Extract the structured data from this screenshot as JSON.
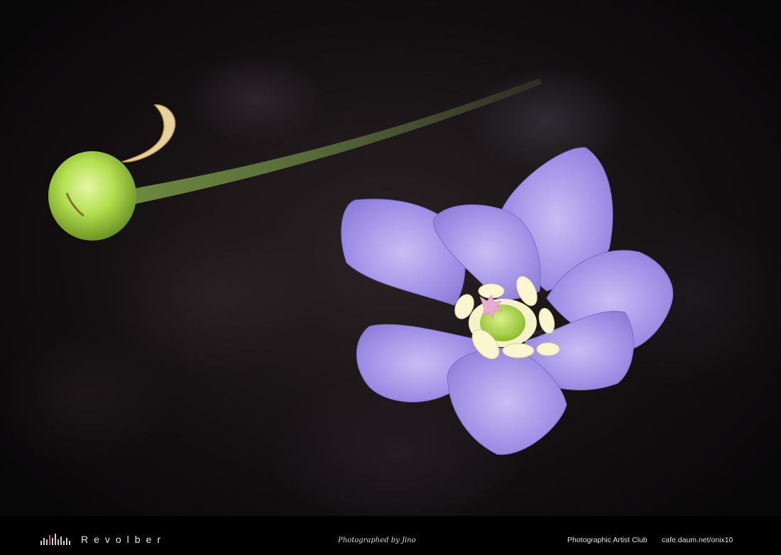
{
  "footer": {
    "brand": "Revolber",
    "photographer": "Photographed by Jino",
    "club": "Photographic Artist Club",
    "url": "cafe.daum.net/onix10"
  },
  "watermark": "Photographed by",
  "colors": {
    "background": "#000000",
    "petal": "#a292e8",
    "stem": "#5a6b3c",
    "bud": "#9fcf3a"
  }
}
